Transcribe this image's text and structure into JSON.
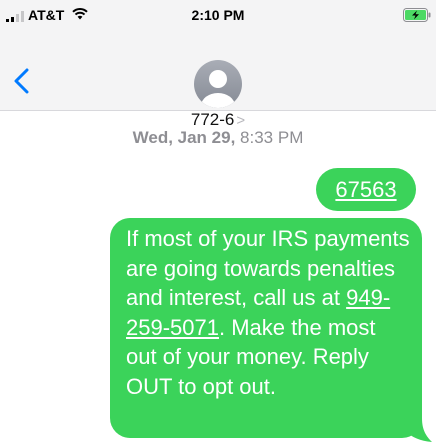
{
  "status_bar": {
    "carrier": "AT&T",
    "time": "2:10 PM",
    "icons": [
      "signal-icon",
      "wifi-icon",
      "battery-charging-icon"
    ],
    "battery_color": "#4cd964"
  },
  "header": {
    "back_icon": "chevron-left-icon",
    "avatar_icon": "person-icon",
    "contact_name": "772-6",
    "contact_chevron": ">"
  },
  "thread": {
    "date": "Wed, Jan 29,",
    "time": "8:33 PM",
    "messages": [
      {
        "text": "67563"
      },
      {
        "text_before_link": "If most of your IRS payments are going towards penalties and interest, call us at ",
        "link": "949-259-5071",
        "text_after_link": ". Make the most out of your money. Reply OUT to opt out."
      }
    ]
  },
  "colors": {
    "bubble": "#3bd35a",
    "accent": "#007aff",
    "header_bg": "#f4f4f5",
    "timestamp": "#8e8e93"
  }
}
